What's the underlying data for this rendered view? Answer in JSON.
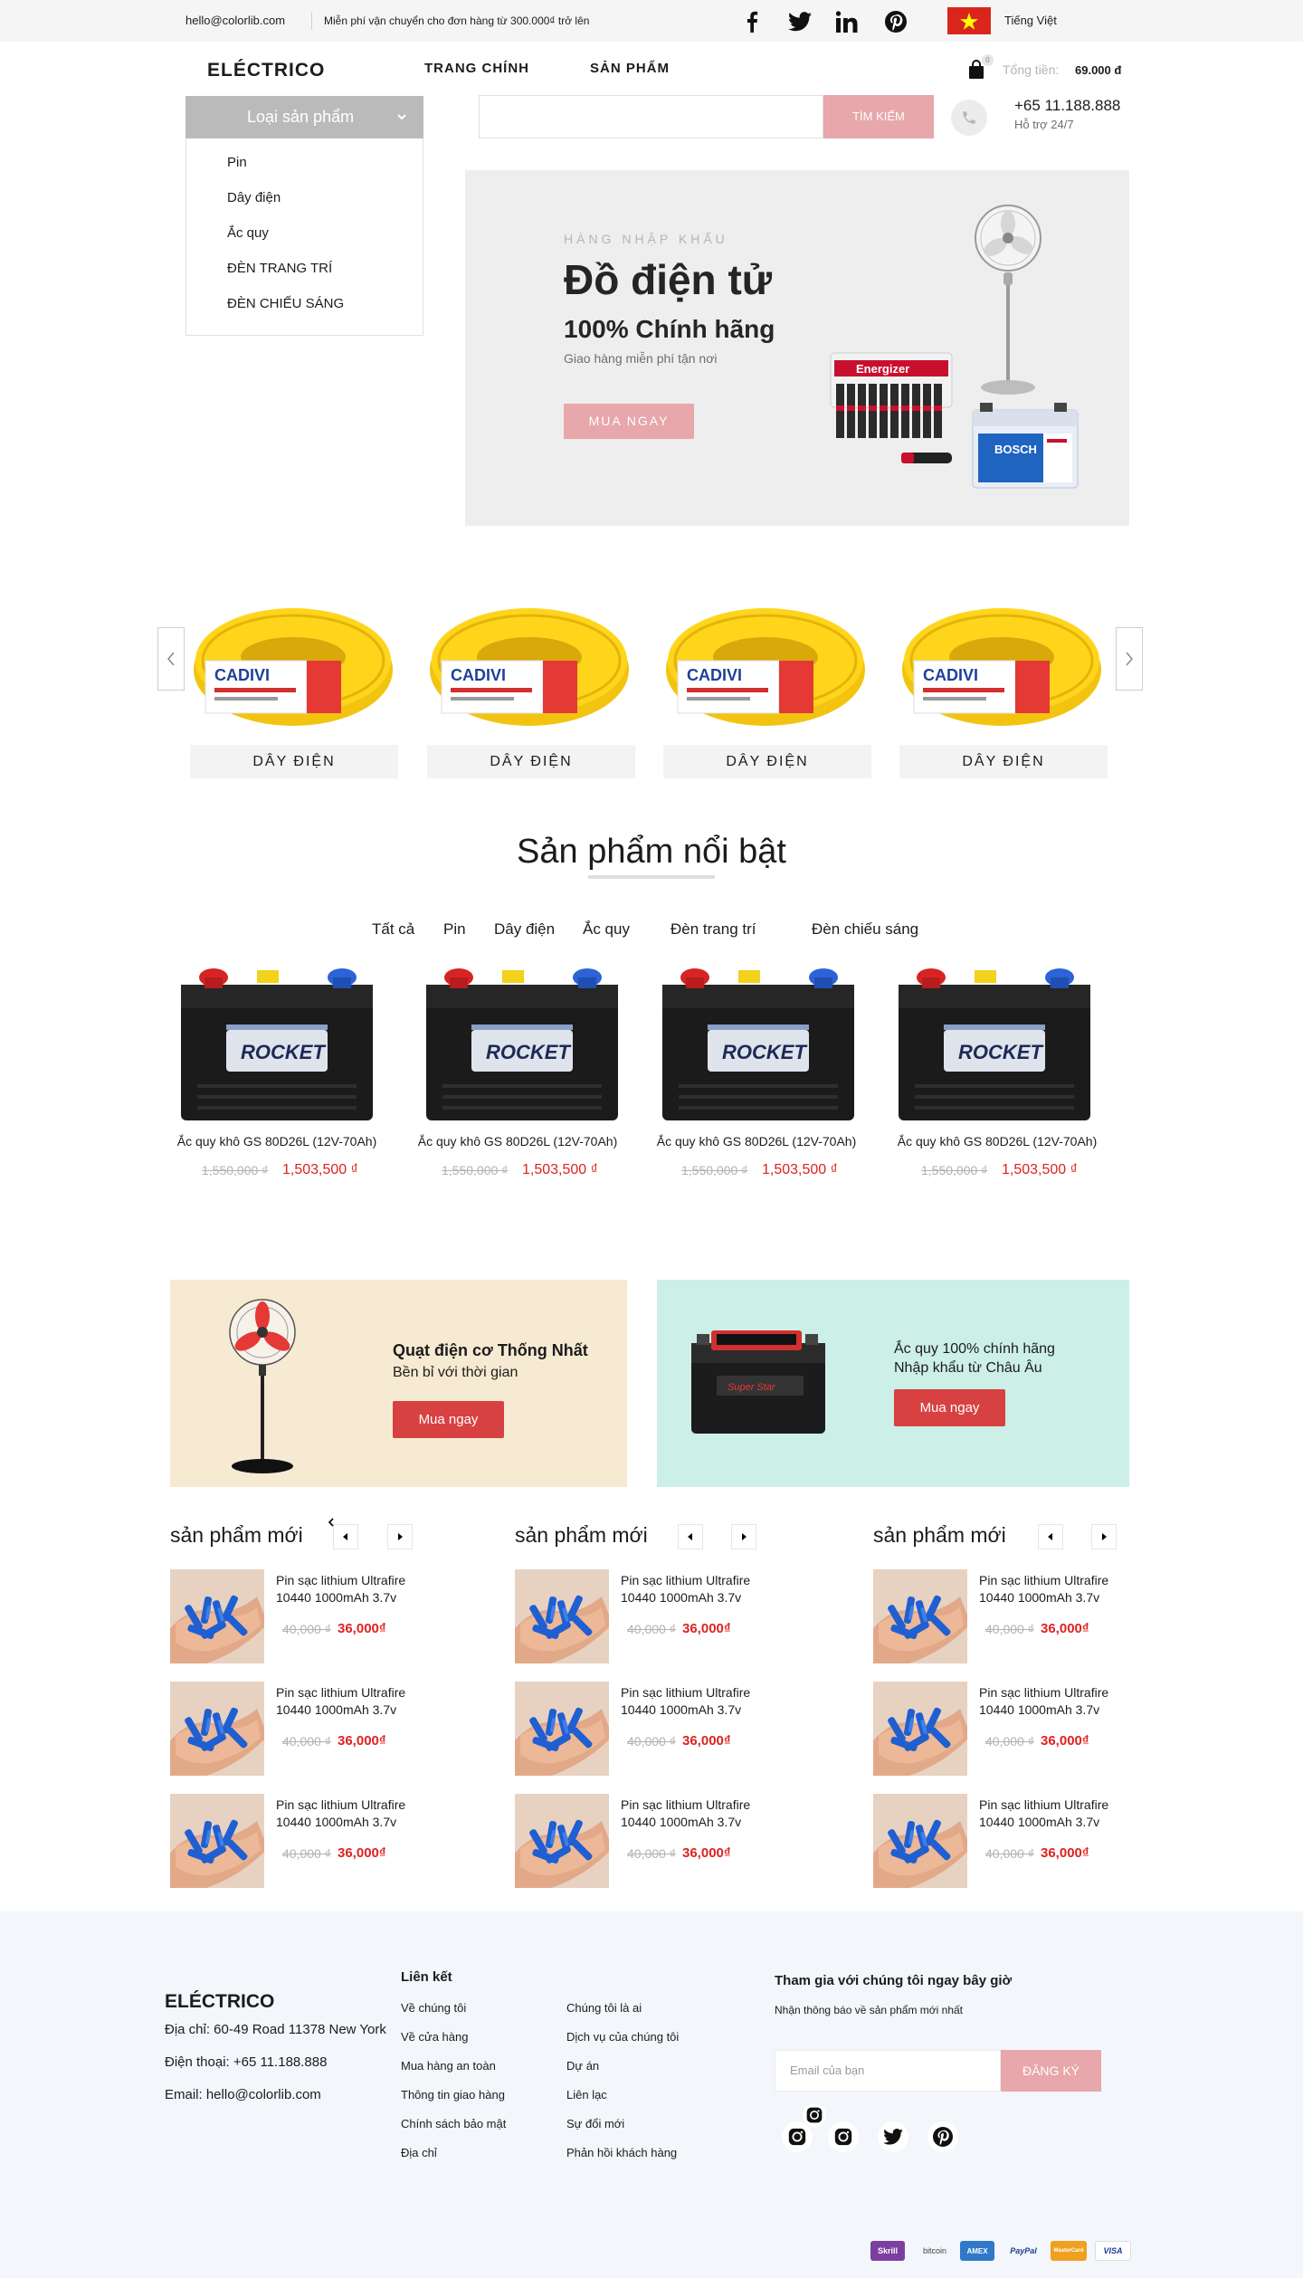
{
  "topbar": {
    "email": "hello@colorlib.com",
    "shipping": "Miễn phí vận chuyển cho đơn hàng từ 300.000₫ trở lên",
    "social_icons": [
      "facebook-icon",
      "twitter-icon",
      "linkedin-icon",
      "pinterest-icon"
    ],
    "language": "Tiếng Việt"
  },
  "header": {
    "logo": "ELÉCTRICO",
    "nav": [
      "TRANG CHÍNH",
      "SẢN PHẨM"
    ],
    "cart_count": "0",
    "total_label": "Tổng tiền:",
    "total_value": "69.000 đ"
  },
  "categories": {
    "title": "Loại sản phẩm",
    "items": [
      "Pin",
      "Dây điện",
      "Ắc quy",
      "ĐÈN TRANG TRÍ",
      "ĐÈN CHIẾU SÁNG"
    ]
  },
  "search": {
    "placeholder": "",
    "button": "TÌM KIẾM"
  },
  "support": {
    "phone": "+65 11.188.888",
    "label": "Hỗ trợ 24/7"
  },
  "hero": {
    "kicker": "HÀNG NHẬP KHẨU",
    "title": "Đồ điện tử",
    "subtitle": "100% Chính hãng",
    "desc": "Giao hàng miễn phí tận nơi",
    "button": "MUA NGAY"
  },
  "category_carousel": {
    "items": [
      "DÂY ĐIỆN",
      "DÂY ĐIỆN",
      "DÂY ĐIỆN",
      "DÂY ĐIỆN"
    ]
  },
  "featured": {
    "title": "Sản phẩm nổi bật",
    "tabs": [
      "Tất cả",
      "Pin",
      "Dây điện",
      "Ắc quy",
      "Đèn trang trí",
      "Đèn chiếu sáng"
    ],
    "products": [
      {
        "name": "Ắc quy khô GS 80D26L (12V-70Ah)",
        "old_price": "1,550,000 ₫",
        "price": "1,503,500 ₫"
      },
      {
        "name": "Ắc quy khô GS 80D26L (12V-70Ah)",
        "old_price": "1,550,000 ₫",
        "price": "1,503,500 ₫"
      },
      {
        "name": "Ắc quy khô GS 80D26L (12V-70Ah)",
        "old_price": "1,550,000 ₫",
        "price": "1,503,500 ₫"
      },
      {
        "name": "Ắc quy khô GS 80D26L (12V-70Ah)",
        "old_price": "1,550,000 ₫",
        "price": "1,503,500 ₫"
      }
    ]
  },
  "promos": [
    {
      "title": "Quạt điện cơ Thống Nhất",
      "subtitle": "Bền bỉ với thời gian",
      "button": "Mua ngay"
    },
    {
      "title": "Ắc quy 100% chính hãng",
      "subtitle": "Nhập khẩu từ Châu Âu",
      "button": "Mua ngay"
    }
  ],
  "latest": {
    "columns": [
      {
        "title": "sản phẩm mới",
        "items": [
          {
            "name": "Pin sạc lithium Ultrafire 10440 1000mAh 3.7v",
            "old_price": "40,000 ₫",
            "price": "36,000₫"
          },
          {
            "name": "Pin sạc lithium Ultrafire 10440 1000mAh 3.7v",
            "old_price": "40,000 ₫",
            "price": "36,000₫"
          },
          {
            "name": "Pin sạc lithium Ultrafire 10440 1000mAh 3.7v",
            "old_price": "40,000 ₫",
            "price": "36,000₫"
          }
        ]
      },
      {
        "title": "sản phẩm mới",
        "items": [
          {
            "name": "Pin sạc lithium Ultrafire 10440 1000mAh 3.7v",
            "old_price": "40,000 ₫",
            "price": "36,000₫"
          },
          {
            "name": "Pin sạc lithium Ultrafire 10440 1000mAh 3.7v",
            "old_price": "40,000 ₫",
            "price": "36,000₫"
          },
          {
            "name": "Pin sạc lithium Ultrafire 10440 1000mAh 3.7v",
            "old_price": "40,000 ₫",
            "price": "36,000₫"
          }
        ]
      },
      {
        "title": "sản phẩm mới",
        "items": [
          {
            "name": "Pin sạc lithium Ultrafire 10440 1000mAh 3.7v",
            "old_price": "40,000 ₫",
            "price": "36,000₫"
          },
          {
            "name": "Pin sạc lithium Ultrafire 10440 1000mAh 3.7v",
            "old_price": "40,000 ₫",
            "price": "36,000₫"
          },
          {
            "name": "Pin sạc lithium Ultrafire 10440 1000mAh 3.7v",
            "old_price": "40,000 ₫",
            "price": "36,000₫"
          }
        ]
      }
    ]
  },
  "footer": {
    "logo": "ELÉCTRICO",
    "address": "Địa chỉ: 60-49 Road 11378 New York",
    "phone": "Điện thoại: +65 11.188.888",
    "email": "Email: hello@colorlib.com",
    "links_title": "Liên kết",
    "links_col1": [
      "Về chúng tôi",
      "Về cửa hàng",
      "Mua hàng an toàn",
      "Thông tin giao hàng",
      "Chính sách bảo mật",
      "Địa chỉ"
    ],
    "links_col2": [
      "Chúng tôi là ai",
      "Dịch vụ của chúng tôi",
      "Dự án",
      "Liên lạc",
      "Sự đổi mới",
      "Phản hồi khách hàng"
    ],
    "newsletter_title": "Tham gia với chúng tôi ngay bây giờ",
    "newsletter_sub": "Nhận thông báo về sản phẩm mới nhất",
    "newsletter_placeholder": "Email của bạn",
    "newsletter_button": "ĐĂNG KÝ",
    "social_icons": [
      "instagram-icon",
      "instagram-icon",
      "twitter-icon",
      "pinterest-icon"
    ],
    "payments": [
      "Skrill",
      "bitcoin",
      "AMEX",
      "PayPal",
      "MasterCard",
      "VISA"
    ]
  },
  "colors": {
    "accent_pink": "#e7a7ab",
    "price_red": "#dd2222",
    "promo_button": "#d84141",
    "promo1_bg": "#f7ead2",
    "promo2_bg": "#ccefe8"
  }
}
